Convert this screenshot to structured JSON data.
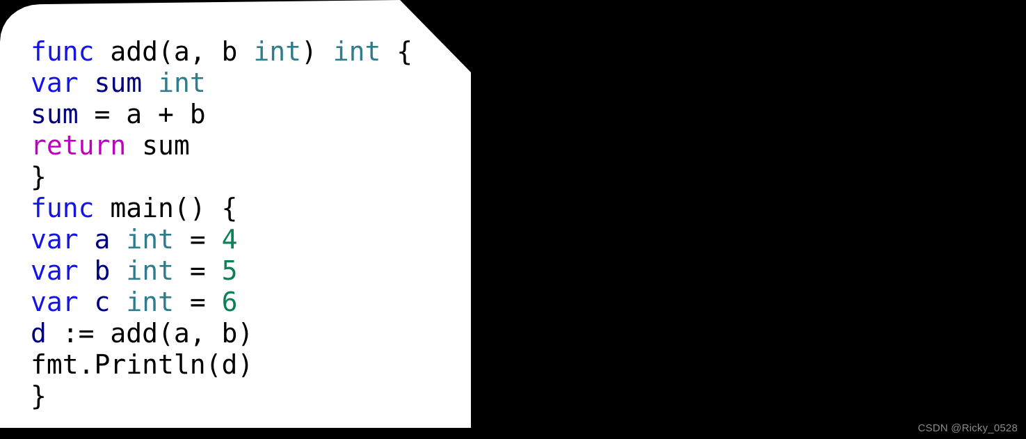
{
  "card": {
    "background_color": "#ffffff",
    "page_background_color": "#000000"
  },
  "palette": {
    "keyword": "#1414e6",
    "control": "#c000c0",
    "function": "#7d6526",
    "type": "#2f7d8c",
    "number": "#0e8055",
    "identifier": "#00007f",
    "plain": "#000000",
    "watermark": "#8a8a8a"
  },
  "code": {
    "language": "go",
    "plain_text": "func add(a, b int) int {\nvar sum int\nsum = a + b\nreturn sum\n}\nfunc main() {\nvar a int = 4\nvar b int = 5\nvar c int = 6\nd := add(a, b)\nfmt.Println(d)\n}",
    "lines": [
      {
        "index": 1,
        "text": "func add(a, b int) int {",
        "tokens": [
          {
            "t": "func",
            "c": "keyword"
          },
          {
            "t": " ",
            "c": "plain"
          },
          {
            "t": "add",
            "c": "function"
          },
          {
            "t": "(a, b ",
            "c": "plain"
          },
          {
            "t": "int",
            "c": "type"
          },
          {
            "t": ") ",
            "c": "plain"
          },
          {
            "t": "int",
            "c": "type"
          },
          {
            "t": " {",
            "c": "plain"
          }
        ]
      },
      {
        "index": 2,
        "text": "var sum int",
        "tokens": [
          {
            "t": "var",
            "c": "keyword"
          },
          {
            "t": " ",
            "c": "plain"
          },
          {
            "t": "sum",
            "c": "identifier"
          },
          {
            "t": " ",
            "c": "plain"
          },
          {
            "t": "int",
            "c": "type"
          }
        ]
      },
      {
        "index": 3,
        "text": "sum = a + b",
        "tokens": [
          {
            "t": "sum",
            "c": "identifier"
          },
          {
            "t": " = a + b",
            "c": "plain"
          }
        ]
      },
      {
        "index": 4,
        "text": "return sum",
        "tokens": [
          {
            "t": "return",
            "c": "control"
          },
          {
            "t": " sum",
            "c": "plain"
          }
        ]
      },
      {
        "index": 5,
        "text": "}",
        "tokens": [
          {
            "t": "}",
            "c": "plain"
          }
        ]
      },
      {
        "index": 6,
        "text": "func main() {",
        "tokens": [
          {
            "t": "func",
            "c": "keyword"
          },
          {
            "t": " ",
            "c": "plain"
          },
          {
            "t": "main",
            "c": "function"
          },
          {
            "t": "() {",
            "c": "plain"
          }
        ]
      },
      {
        "index": 7,
        "text": "var a int = 4",
        "tokens": [
          {
            "t": "var",
            "c": "keyword"
          },
          {
            "t": " ",
            "c": "plain"
          },
          {
            "t": "a",
            "c": "identifier"
          },
          {
            "t": " ",
            "c": "plain"
          },
          {
            "t": "int",
            "c": "type"
          },
          {
            "t": " = ",
            "c": "plain"
          },
          {
            "t": "4",
            "c": "number"
          }
        ]
      },
      {
        "index": 8,
        "text": "var b int = 5",
        "tokens": [
          {
            "t": "var",
            "c": "keyword"
          },
          {
            "t": " ",
            "c": "plain"
          },
          {
            "t": "b",
            "c": "identifier"
          },
          {
            "t": " ",
            "c": "plain"
          },
          {
            "t": "int",
            "c": "type"
          },
          {
            "t": " = ",
            "c": "plain"
          },
          {
            "t": "5",
            "c": "number"
          }
        ]
      },
      {
        "index": 9,
        "text": "var c int = 6",
        "tokens": [
          {
            "t": "var",
            "c": "keyword"
          },
          {
            "t": " ",
            "c": "plain"
          },
          {
            "t": "c",
            "c": "identifier"
          },
          {
            "t": " ",
            "c": "plain"
          },
          {
            "t": "int",
            "c": "type"
          },
          {
            "t": " = ",
            "c": "plain"
          },
          {
            "t": "6",
            "c": "number"
          }
        ]
      },
      {
        "index": 10,
        "text": "d := add(a, b)",
        "tokens": [
          {
            "t": "d",
            "c": "identifier"
          },
          {
            "t": " := ",
            "c": "plain"
          },
          {
            "t": "add",
            "c": "function"
          },
          {
            "t": "(a, b)",
            "c": "plain"
          }
        ]
      },
      {
        "index": 11,
        "text": "fmt.Println(d)",
        "tokens": [
          {
            "t": "fmt.",
            "c": "plain"
          },
          {
            "t": "Println",
            "c": "function"
          },
          {
            "t": "(d)",
            "c": "plain"
          }
        ]
      },
      {
        "index": 12,
        "text": "}",
        "tokens": [
          {
            "t": "}",
            "c": "plain"
          }
        ]
      }
    ]
  },
  "watermark": {
    "text": "CSDN @Ricky_0528"
  }
}
